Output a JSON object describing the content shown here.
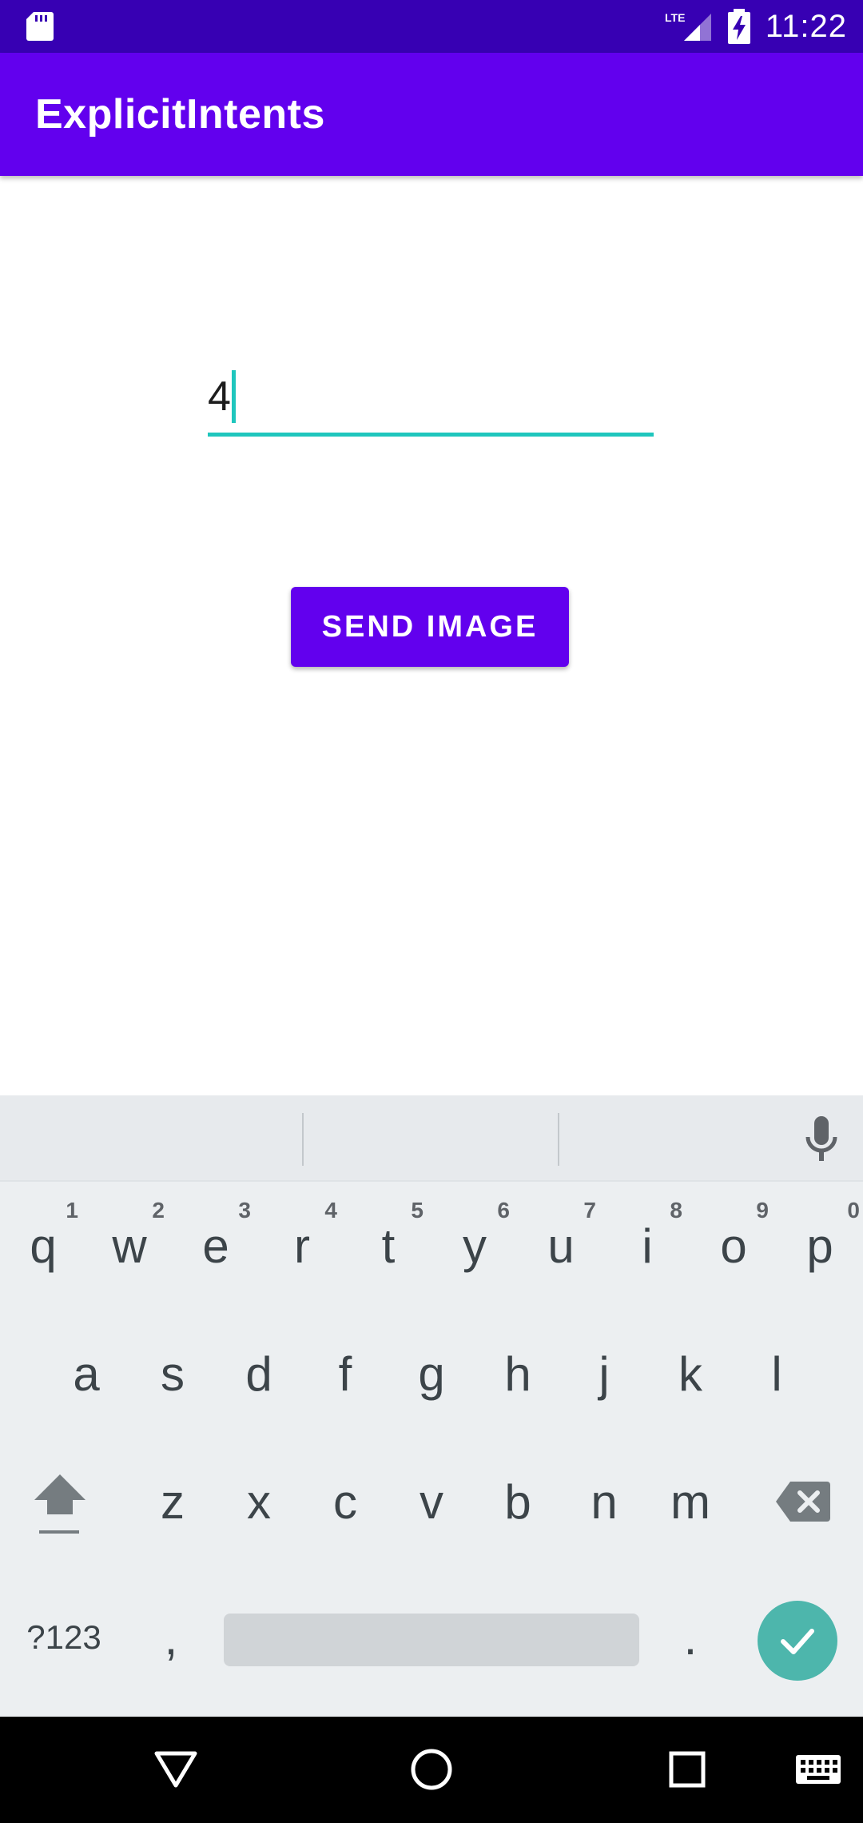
{
  "status_bar": {
    "time": "11:22",
    "network_label": "LTE",
    "icons": [
      "sd-card-icon",
      "lte-signal-icon",
      "battery-charging-icon"
    ]
  },
  "app_bar": {
    "title": "ExplicitIntents"
  },
  "main": {
    "input_value": "4",
    "send_button_label": "SEND IMAGE"
  },
  "keyboard": {
    "row1": [
      {
        "key": "q",
        "hint": "1"
      },
      {
        "key": "w",
        "hint": "2"
      },
      {
        "key": "e",
        "hint": "3"
      },
      {
        "key": "r",
        "hint": "4"
      },
      {
        "key": "t",
        "hint": "5"
      },
      {
        "key": "y",
        "hint": "6"
      },
      {
        "key": "u",
        "hint": "7"
      },
      {
        "key": "i",
        "hint": "8"
      },
      {
        "key": "o",
        "hint": "9"
      },
      {
        "key": "p",
        "hint": "0"
      }
    ],
    "row2": [
      "a",
      "s",
      "d",
      "f",
      "g",
      "h",
      "j",
      "k",
      "l"
    ],
    "row3": [
      "z",
      "x",
      "c",
      "v",
      "b",
      "n",
      "m"
    ],
    "symbols_label": "?123",
    "comma_label": ",",
    "period_label": "."
  },
  "colors": {
    "status_bar": "#3700b3",
    "primary": "#6200ee",
    "accent": "#1fc6bd",
    "keyboard_bg": "#eceff1",
    "enter_key": "#4db6ac"
  },
  "nav_bar": {
    "icons": [
      "back-icon",
      "home-icon",
      "recents-icon",
      "keyboard-switch-icon"
    ]
  }
}
